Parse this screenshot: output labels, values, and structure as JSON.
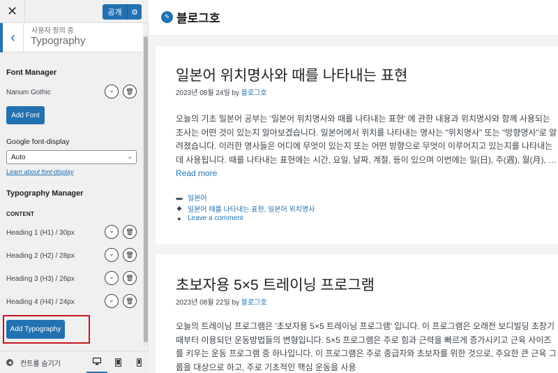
{
  "topbar": {
    "close_label": "✕",
    "publish_label": "공개",
    "publish_gear": "⚙"
  },
  "section": {
    "back": "‹",
    "crumb": "사용자 정의 중",
    "title": "Typography"
  },
  "font_manager": {
    "heading": "Font Manager",
    "font_name": "Nanum Gothic",
    "add_font_label": "Add Font",
    "display_label": "Google font-display",
    "display_value": "Auto",
    "learn_link": "Learn about font-display"
  },
  "typography_manager": {
    "heading": "Typography Manager",
    "group_label": "CONTENT",
    "items": [
      {
        "label": "Heading 1 (H1) / 30px"
      },
      {
        "label": "Heading 2 (H2) / 28px"
      },
      {
        "label": "Heading 3 (H3) / 26px"
      },
      {
        "label": "Heading 4 (H4) / 24px"
      }
    ],
    "add_typography_label": "Add Typography"
  },
  "footer": {
    "hide_controls_label": "컨트롤 숨기기"
  },
  "icons": {
    "expand": "⌄",
    "delete": "🗑",
    "desktop": "desktop-icon",
    "tablet": "tablet-icon",
    "mobile": "mobile-icon"
  },
  "site": {
    "title": "블로그호"
  },
  "posts": [
    {
      "title": "일본어 위치명사와 때를 나타내는 표현",
      "date": "2023년 08월 24일",
      "by": "by",
      "author": "블로그호",
      "excerpt": "오늘의 기초 일본어 공부는 '일본어 위치명사와 때를 나타내는 표현' 에 관한 내용과 위치명사와 함께 사용되는 조사는 어떤 것이 있는지 알아보겠습니다. 일본어에서 위치를 나타내는 명사는 \"위치명사\" 또는 \"방향명사\"로 알려졌습니다. 이러한 명사들은 어디에 무엇이 있는지 또는 어떤 방향으로 무엇이 이루어지고 있는지를 나타내는 데 사용됩니다. 때를 나타내는 표현에는 시간, 요일, 날짜, 계절, 등이 있으며 이번에는 일(日), 주(週), 월(月), …",
      "read_more": "Read more",
      "category": "일본어",
      "tags": "일본어 때를 나타내는 표현, 일본어 위치명사",
      "comment": "Leave a comment"
    },
    {
      "title": "초보자용 5×5 트레이닝 프로그램",
      "date": "2023년 08월 22일",
      "by": "by",
      "author": "블로그호",
      "excerpt": "오늘의 트레이닝 프로그램은 '초보자용 5×5 트레이닝 프로그램' 입니다. 이 프로그램은 오래전 보디빌딩 초창기 때부터 이용되던 운동방법들의 변형입니다. 5×5 프로그램은 주로 힘과 근력을 빠르게 증가시키고 근육 사이즈를 키우는 운동 프로그램 중 하나입니다. 이 프로그램은 주로 중급자와 초보자를 위한 것으로, 주요한 큰 근육 그룹을 대상으로 하고, 주로 기초적인 핵심 운동을 사용"
    }
  ],
  "colors": {
    "accent": "#2271b1",
    "highlight": "#c3161c"
  }
}
